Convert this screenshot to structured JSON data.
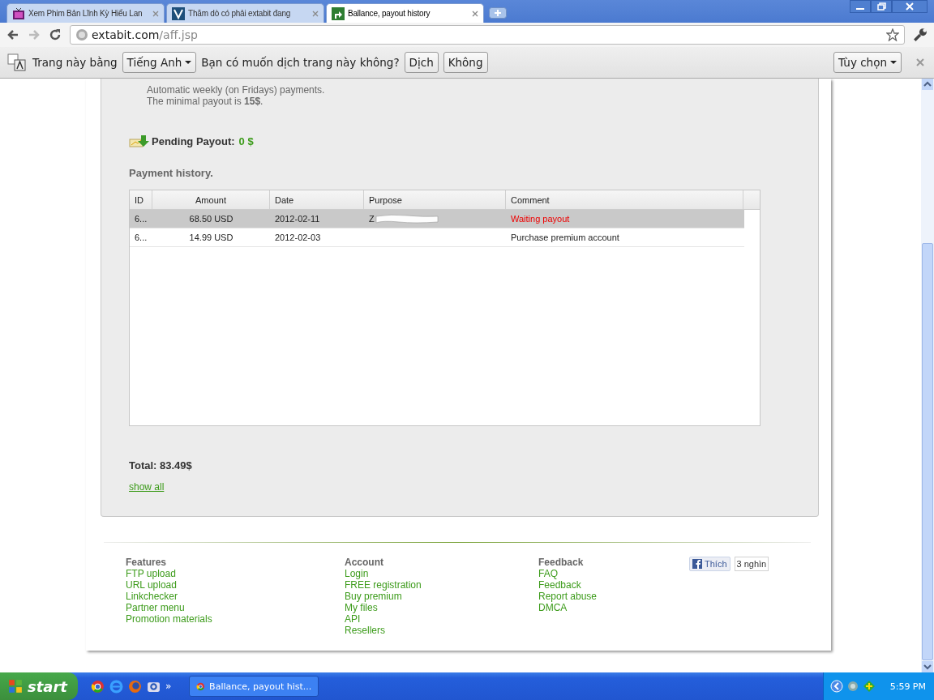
{
  "tabs": [
    {
      "title": "Xem Phim Bản Lĩnh Kỳ Hiểu Lan",
      "selected": false
    },
    {
      "title": "Thăm dò có phải extabit đang",
      "selected": false
    },
    {
      "title": "Ballance, payout history",
      "selected": true
    }
  ],
  "address": {
    "host": "extabit.com",
    "path": "/aff.jsp"
  },
  "translate_bar": {
    "prefix": "Trang này bằng",
    "language": "Tiếng Anh",
    "question": "Bạn có muốn dịch trang này không?",
    "buttons": [
      "Dịch",
      "Không"
    ],
    "options": "Tùy chọn"
  },
  "payments": {
    "lines": [
      "Automatic weekly (on Fridays) payments.",
      "The minimal payout is **15$**."
    ],
    "pending_label": "Pending Payout:",
    "pending_value": "0 $",
    "history_title": "Payment history.",
    "table": {
      "columns": [
        "ID",
        "Amount",
        "Date",
        "Purpose",
        "Comment"
      ],
      "rows": [
        {
          "cells": [
            "6...",
            "68.50 USD",
            "2012-02-11",
            "Z",
            "Waiting payout"
          ],
          "selected": true,
          "redacted": true,
          "alert": true
        },
        {
          "cells": [
            "6...",
            "14.99 USD",
            "2012-02-03",
            "",
            "Purchase premium account"
          ],
          "selected": false,
          "redacted": false,
          "alert": false
        }
      ]
    },
    "total": "Total: 83.49$",
    "show_all": "show all"
  },
  "footer": {
    "columns": [
      {
        "title": "Features",
        "links": [
          "FTP upload",
          "URL upload",
          "Linkchecker",
          "Partner menu",
          "Promotion materials"
        ]
      },
      {
        "title": "Account",
        "links": [
          "Login",
          "FREE registration",
          "Buy premium",
          "My files",
          "API",
          "Resellers"
        ]
      },
      {
        "title": "Feedback",
        "links": [
          "FAQ",
          "Feedback",
          "Report abuse",
          "DMCA"
        ]
      }
    ],
    "like": {
      "label": "Thích",
      "count": "3 nghìn"
    }
  },
  "taskbar": {
    "start": "start",
    "more": "»",
    "task": "Ballance, payout hist...",
    "clock": "5:59 PM"
  }
}
